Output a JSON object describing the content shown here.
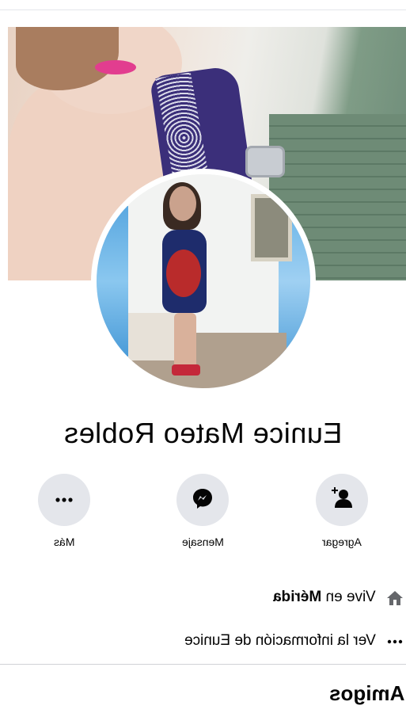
{
  "profile": {
    "name": "Eunice Mateo Robles"
  },
  "actions": [
    {
      "label": "Agregar",
      "icon": "add-friend-icon"
    },
    {
      "label": "Mensaje",
      "icon": "messenger-icon"
    },
    {
      "label": "Más",
      "icon": "more-icon"
    }
  ],
  "info": {
    "lives_prefix": "Vive en ",
    "lives_city": "Mérida",
    "see_info": "Ver la información de Eunice"
  },
  "sections": {
    "friends_title": "Amigos"
  },
  "colors": {
    "button_bg": "#e4e6eb",
    "text": "#050505"
  }
}
